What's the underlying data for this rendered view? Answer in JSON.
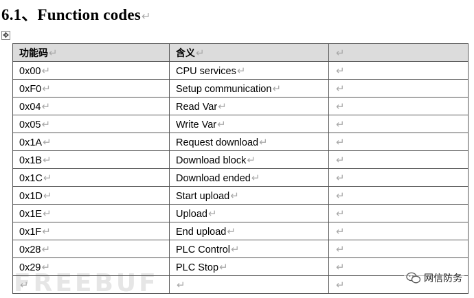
{
  "heading": {
    "text": "6.1、Function codes",
    "mark": "↵"
  },
  "table": {
    "headers": [
      "功能码",
      "含义",
      ""
    ],
    "rows": [
      [
        "0x00",
        "CPU services",
        ""
      ],
      [
        "0xF0",
        "Setup communication",
        ""
      ],
      [
        "0x04",
        "Read Var",
        ""
      ],
      [
        "0x05",
        "Write Var",
        ""
      ],
      [
        "0x1A",
        "Request download",
        ""
      ],
      [
        "0x1B",
        "Download block",
        ""
      ],
      [
        "0x1C",
        "Download ended",
        ""
      ],
      [
        "0x1D",
        "Start upload",
        ""
      ],
      [
        "0x1E",
        "Upload",
        ""
      ],
      [
        "0x1F",
        "End upload",
        ""
      ],
      [
        "0x28",
        "PLC Control",
        ""
      ],
      [
        "0x29",
        "PLC Stop",
        ""
      ],
      [
        "",
        "",
        ""
      ]
    ]
  },
  "watermark": {
    "text": "FREEBUF",
    "brand": "网信防务"
  },
  "icons": {
    "move_handle": "move-handle-icon",
    "wechat": "wechat-icon"
  }
}
